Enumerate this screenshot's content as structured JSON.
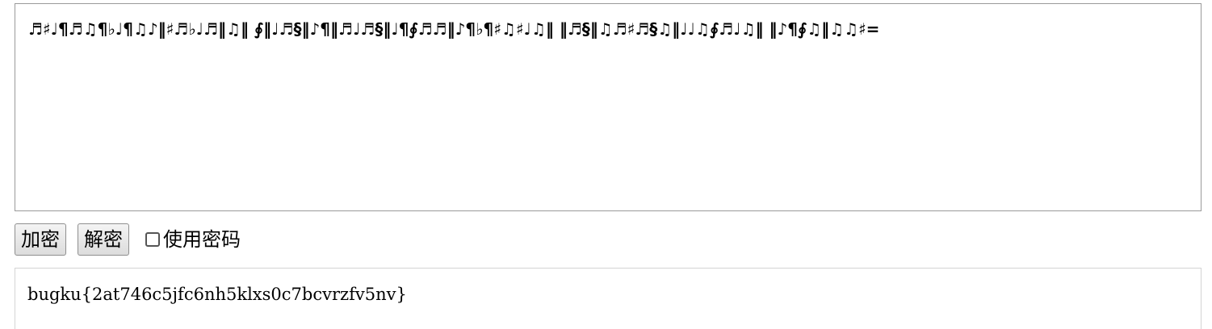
{
  "input": {
    "text": "♬♯♩¶♬♫¶♭♩¶♫♪‖♯♬♭♩♬‖♫‖ ∮‖♩♬§‖♪¶‖♬♩♬§‖♩¶∮♬♬‖♪¶♭¶♯♫♯♩♫‖ ‖♬§‖♫♬♯♬§♫‖♩♩♫∮♬♩♫‖ ‖♪¶∮♫‖♫♫♯="
  },
  "controls": {
    "encrypt_label": "加密",
    "decrypt_label": "解密",
    "use_password_label": "使用密码",
    "use_password_checked": false
  },
  "output": {
    "text": "bugku{2at746c5jfc6nh5klxs0c7bcvrzfv5nv}"
  }
}
